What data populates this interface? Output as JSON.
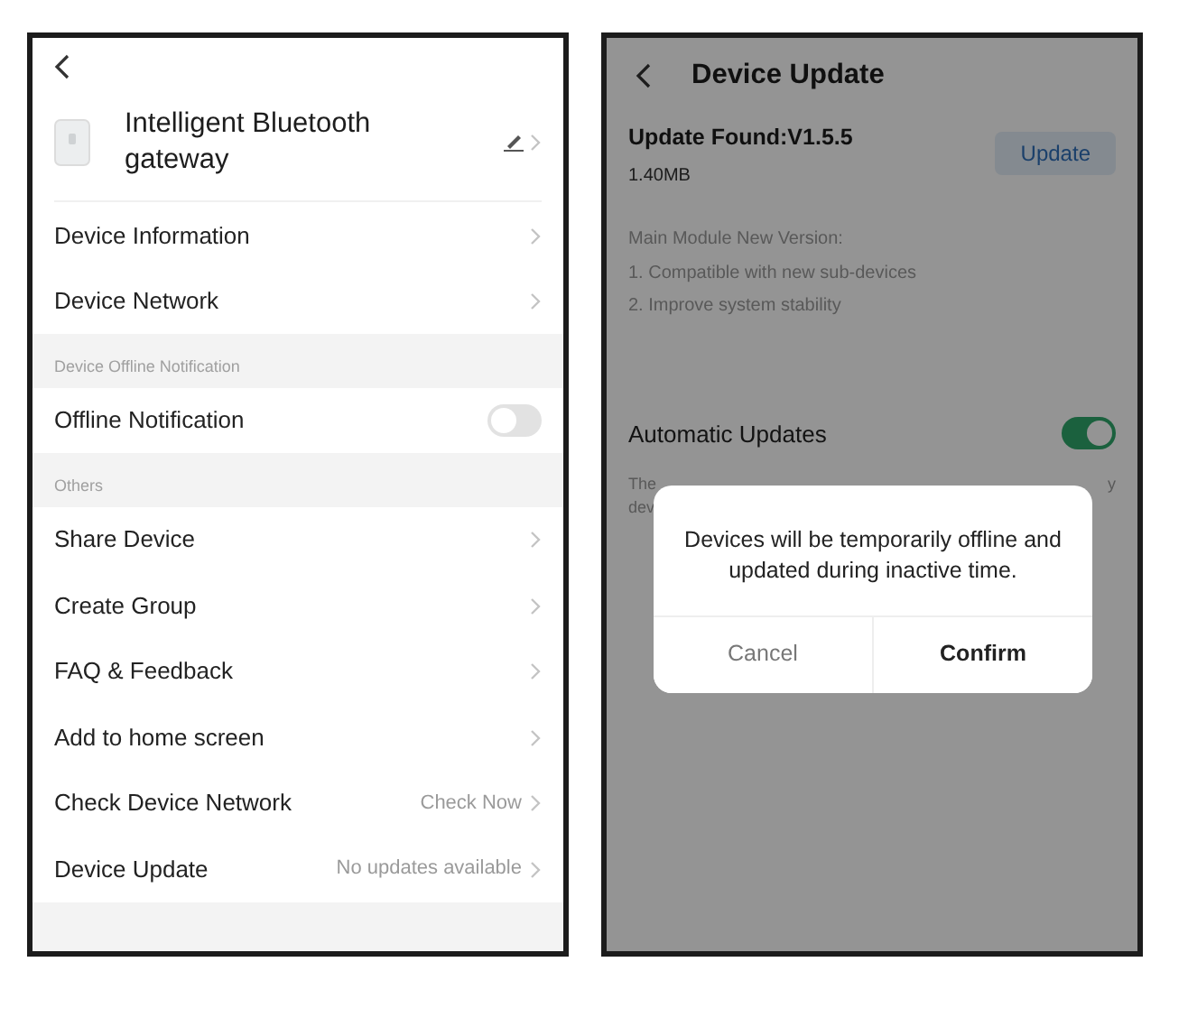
{
  "settings_screen": {
    "device": {
      "name": "Intelligent Bluetooth gateway"
    },
    "sections": [
      {
        "items": [
          {
            "kind": "link",
            "label": "Device Information"
          },
          {
            "kind": "link",
            "label": "Device Network"
          }
        ]
      },
      {
        "title": "Device Offline Notification",
        "items": [
          {
            "kind": "toggle",
            "label": "Offline Notification",
            "on": false
          }
        ]
      },
      {
        "title": "Others",
        "items": [
          {
            "kind": "link",
            "label": "Share Device"
          },
          {
            "kind": "link",
            "label": "Create Group"
          },
          {
            "kind": "link",
            "label": "FAQ & Feedback"
          },
          {
            "kind": "link",
            "label": "Add to home screen"
          },
          {
            "kind": "link",
            "label": "Check Device Network",
            "value": "Check Now"
          },
          {
            "kind": "link",
            "label": "Device Update",
            "value": "No updates available"
          }
        ]
      }
    ]
  },
  "update_screen": {
    "title": "Device Update",
    "update_found": "Update Found:V1.5.5",
    "size": "1.40MB",
    "update_button": "Update",
    "notes": [
      "Main Module New Version:",
      "1. Compatible with new sub-devices",
      "2. Improve system stability"
    ],
    "auto_updates": {
      "label": "Automatic Updates",
      "on": true
    },
    "note_fragments": [
      "The",
      "dev"
    ],
    "note_fragment_right": "y",
    "dialog": {
      "message": "Devices will be temporarily offline and updated during inactive time.",
      "buttons": [
        {
          "kind": "cancel",
          "label": "Cancel"
        },
        {
          "kind": "confirm",
          "label": "Confirm"
        }
      ]
    }
  }
}
